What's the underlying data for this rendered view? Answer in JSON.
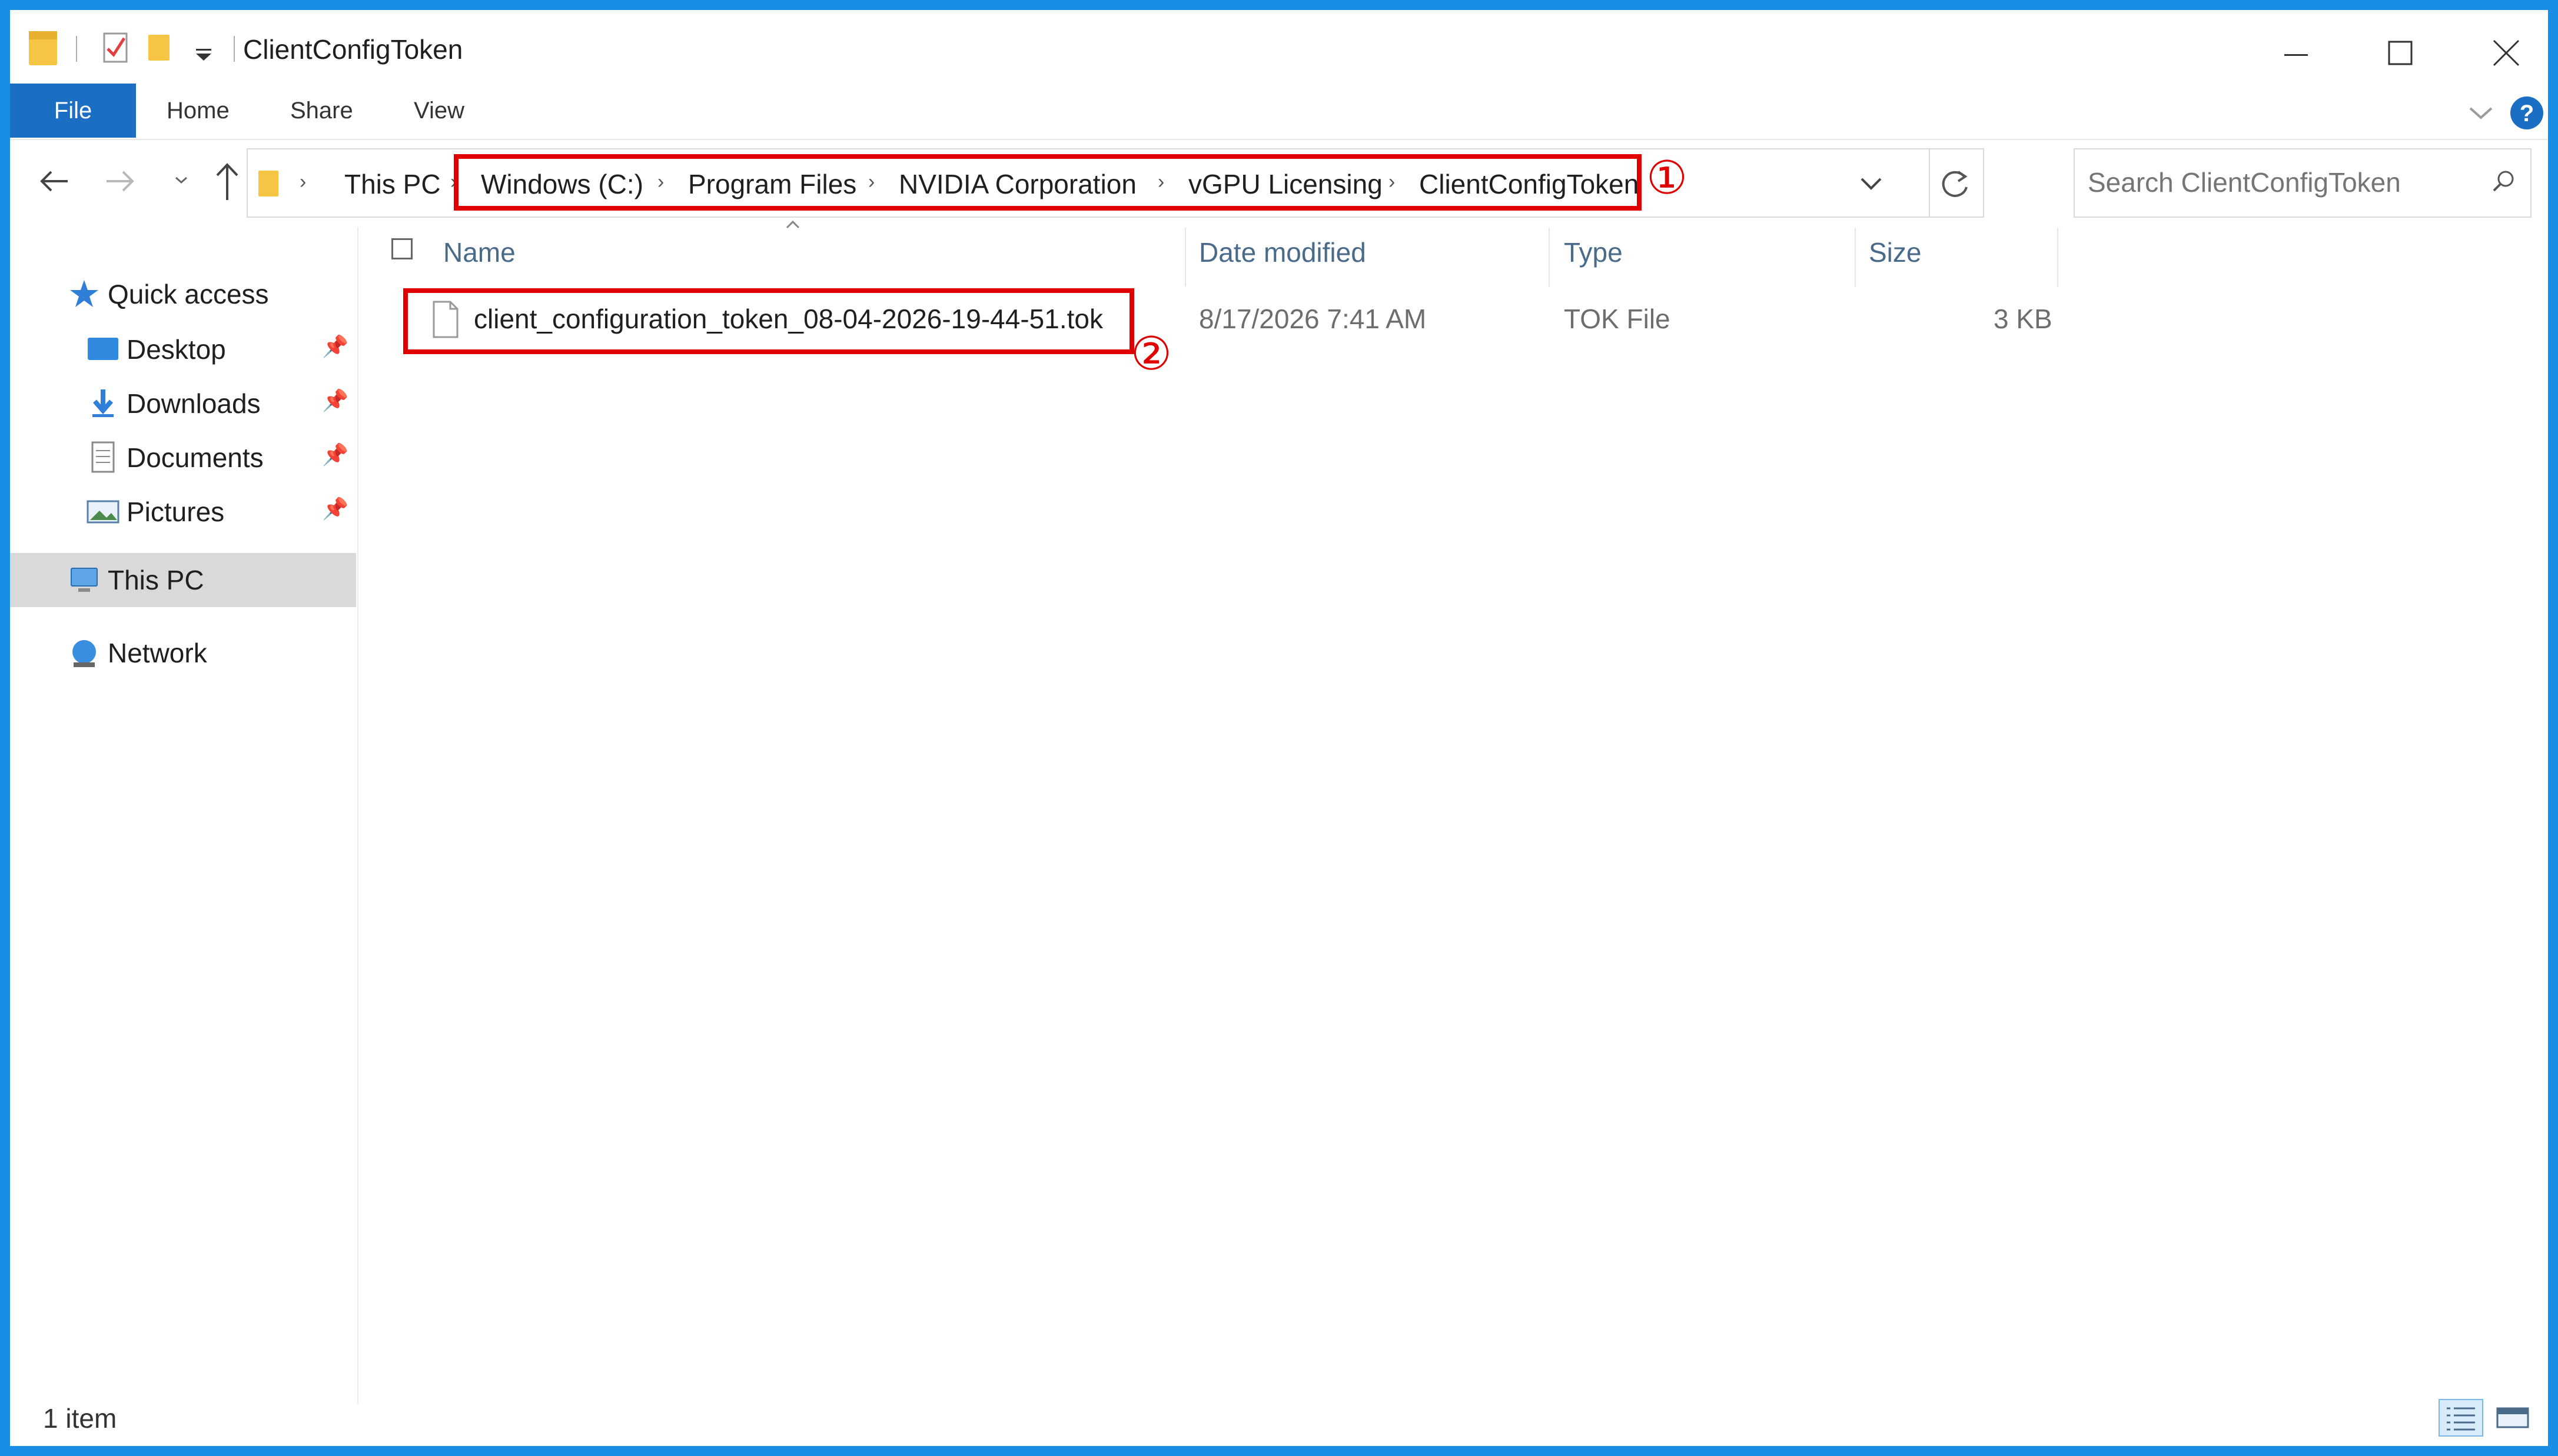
{
  "window": {
    "title": "ClientConfigToken"
  },
  "ribbon": {
    "tabs": [
      "File",
      "Home",
      "Share",
      "View"
    ]
  },
  "address": {
    "crumbs": [
      "This PC",
      "Windows (C:)",
      "Program Files",
      "NVIDIA Corporation",
      "vGPU Licensing",
      "ClientConfigToken"
    ]
  },
  "search": {
    "placeholder": "Search ClientConfigToken"
  },
  "navpane": {
    "quick_access": "Quick access",
    "desktop": "Desktop",
    "downloads": "Downloads",
    "documents": "Documents",
    "pictures": "Pictures",
    "this_pc": "This PC",
    "network": "Network"
  },
  "columns": {
    "name": "Name",
    "date_modified": "Date modified",
    "type": "Type",
    "size": "Size"
  },
  "files": [
    {
      "name": "client_configuration_token_08-04-2026-19-44-51.tok",
      "date_modified": "8/17/2026 7:41 AM",
      "type": "TOK File",
      "size": "3 KB"
    }
  ],
  "annotations": {
    "marker_1": "①",
    "marker_2": "②"
  },
  "status": {
    "item_count": "1 item"
  },
  "colors": {
    "accent": "#1a6ec4",
    "highlight_red": "#e00000",
    "selected_nav": "#d9d9d9",
    "desktop_border": "#1a8ee6"
  }
}
